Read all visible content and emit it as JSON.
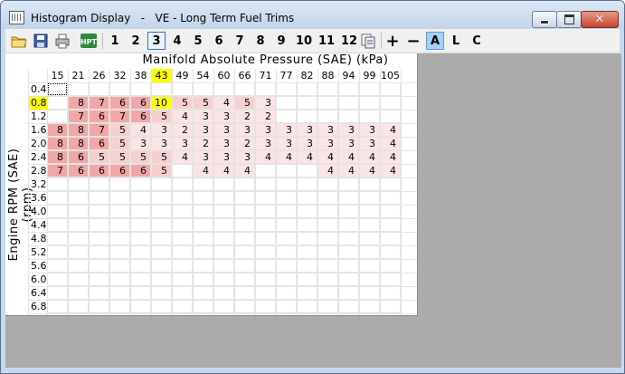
{
  "window": {
    "title": "Histogram Display   -   VE - Long Term Fuel Trims"
  },
  "toolbar": {
    "icons": [
      "open-folder-icon",
      "save-disk-icon",
      "print-icon",
      "hpt-logo-icon"
    ],
    "numbers": [
      "1",
      "2",
      "3",
      "4",
      "5",
      "6",
      "7",
      "8",
      "9",
      "10",
      "11",
      "12"
    ],
    "selected_number": "3",
    "copy_icon": "copy-table-icon",
    "plus": "+",
    "minus": "−",
    "mode_a": "A",
    "mode_l": "L",
    "mode_c": "C",
    "active_mode": "A"
  },
  "table": {
    "x_axis_title": "Manifold Absolute Pressure (SAE) (kPa)",
    "y_axis_title": "Engine RPM (SAE) (rpm)",
    "columns": [
      "15",
      "21",
      "26",
      "32",
      "38",
      "43",
      "49",
      "54",
      "60",
      "66",
      "71",
      "77",
      "82",
      "88",
      "94",
      "99",
      "105"
    ],
    "rows": [
      "0.4",
      "0.8",
      "1.2",
      "1.6",
      "2.0",
      "2.4",
      "2.8",
      "3.2",
      "3.6",
      "4.0",
      "4.4",
      "4.8",
      "5.2",
      "5.6",
      "6.0",
      "6.4",
      "6.8"
    ],
    "highlight_column": "43",
    "highlight_row": "0.8",
    "values": [
      [
        "",
        "",
        "",
        "",
        "",
        "",
        "",
        "",
        "",
        "",
        "",
        "",
        "",
        "",
        "",
        "",
        ""
      ],
      [
        "",
        "8",
        "7",
        "6",
        "6",
        "10",
        "5",
        "5",
        "4",
        "5",
        "3",
        "",
        "",
        "",
        "",
        "",
        ""
      ],
      [
        "",
        "7",
        "6",
        "7",
        "6",
        "5",
        "4",
        "3",
        "3",
        "2",
        "2",
        "",
        "",
        "",
        "",
        "",
        ""
      ],
      [
        "8",
        "8",
        "7",
        "5",
        "4",
        "3",
        "2",
        "3",
        "3",
        "3",
        "3",
        "3",
        "3",
        "3",
        "3",
        "3",
        "4"
      ],
      [
        "8",
        "8",
        "6",
        "5",
        "3",
        "3",
        "3",
        "2",
        "3",
        "2",
        "3",
        "3",
        "3",
        "3",
        "3",
        "3",
        "4"
      ],
      [
        "8",
        "6",
        "5",
        "5",
        "5",
        "5",
        "4",
        "3",
        "3",
        "3",
        "4",
        "4",
        "4",
        "4",
        "4",
        "4",
        "4"
      ],
      [
        "7",
        "6",
        "6",
        "6",
        "6",
        "5",
        "",
        "4",
        "4",
        "4",
        "",
        "",
        "",
        "4",
        "4",
        "4",
        "4"
      ],
      [
        "",
        "",
        "",
        "",
        "",
        "",
        "",
        "",
        "",
        "",
        "",
        "",
        "",
        "",
        "",
        "",
        ""
      ],
      [
        "",
        "",
        "",
        "",
        "",
        "",
        "",
        "",
        "",
        "",
        "",
        "",
        "",
        "",
        "",
        "",
        ""
      ],
      [
        "",
        "",
        "",
        "",
        "",
        "",
        "",
        "",
        "",
        "",
        "",
        "",
        "",
        "",
        "",
        "",
        ""
      ],
      [
        "",
        "",
        "",
        "",
        "",
        "",
        "",
        "",
        "",
        "",
        "",
        "",
        "",
        "",
        "",
        "",
        ""
      ],
      [
        "",
        "",
        "",
        "",
        "",
        "",
        "",
        "",
        "",
        "",
        "",
        "",
        "",
        "",
        "",
        "",
        ""
      ],
      [
        "",
        "",
        "",
        "",
        "",
        "",
        "",
        "",
        "",
        "",
        "",
        "",
        "",
        "",
        "",
        "",
        ""
      ],
      [
        "",
        "",
        "",
        "",
        "",
        "",
        "",
        "",
        "",
        "",
        "",
        "",
        "",
        "",
        "",
        "",
        ""
      ],
      [
        "",
        "",
        "",
        "",
        "",
        "",
        "",
        "",
        "",
        "",
        "",
        "",
        "",
        "",
        "",
        "",
        ""
      ],
      [
        "",
        "",
        "",
        "",
        "",
        "",
        "",
        "",
        "",
        "",
        "",
        "",
        "",
        "",
        "",
        "",
        ""
      ],
      [
        "",
        "",
        "",
        "",
        "",
        "",
        "",
        "",
        "",
        "",
        "",
        "",
        "",
        "",
        "",
        "",
        ""
      ]
    ],
    "colors": {
      "highlight": "#ffff00",
      "heat_high": "#f2a7a7",
      "heat_mid": "#f8cfcf",
      "heat_low": "#fbe4e4",
      "empty": "#ffffff"
    }
  }
}
